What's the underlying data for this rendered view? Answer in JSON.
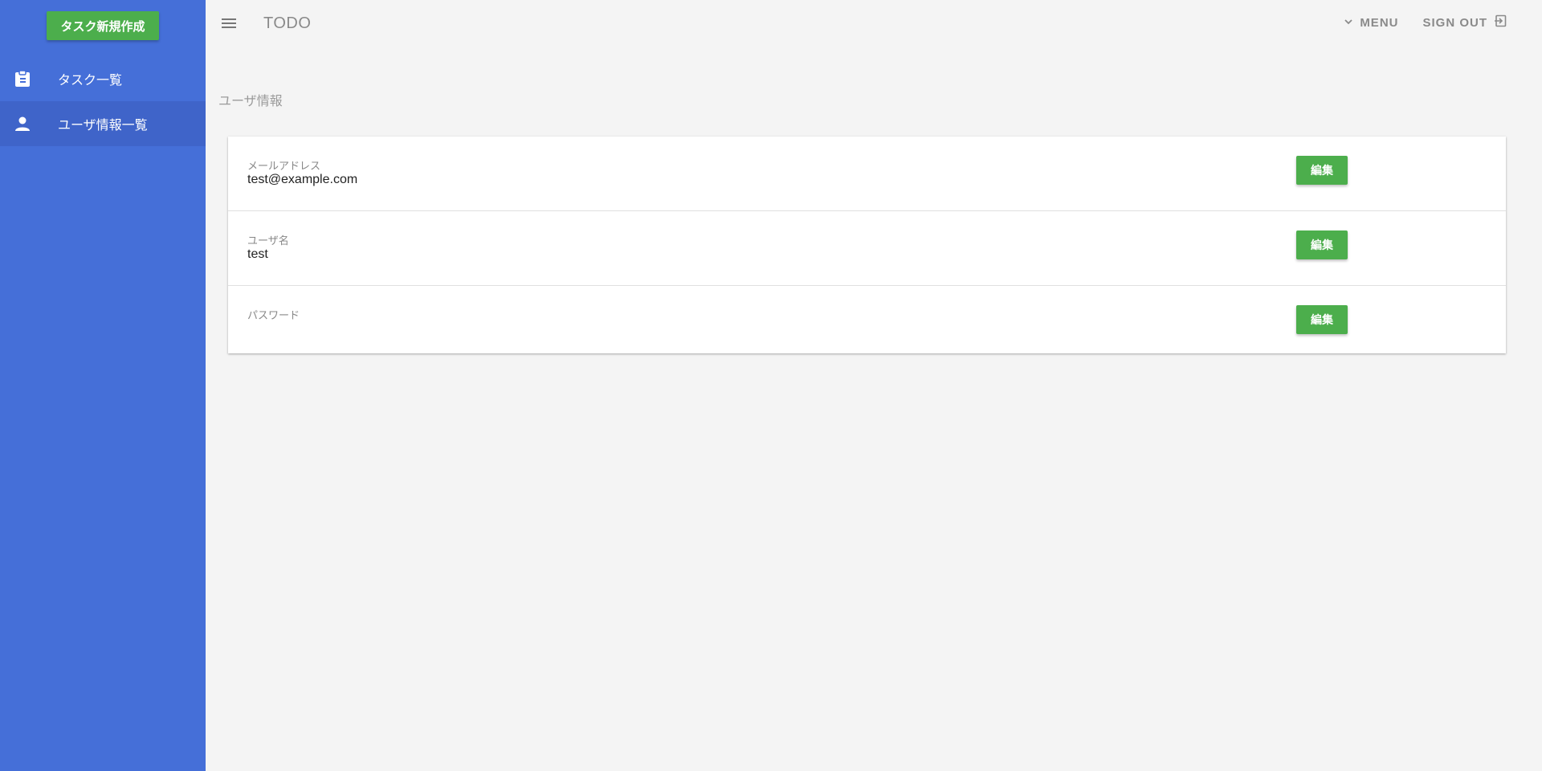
{
  "sidebar": {
    "new_task_label": "タスク新規作成",
    "items": [
      {
        "label": "タスク一覧",
        "icon": "clipboard-icon",
        "active": false
      },
      {
        "label": "ユーザ情報一覧",
        "icon": "person-icon",
        "active": true
      }
    ]
  },
  "topbar": {
    "title": "TODO",
    "menu_label": "MENU",
    "signout_label": "SIGN OUT"
  },
  "page": {
    "heading": "ユーザ情報"
  },
  "user_info": {
    "rows": [
      {
        "label": "メールアドレス",
        "value": "test@example.com",
        "button": "編集"
      },
      {
        "label": "ユーザ名",
        "value": "test",
        "button": "編集"
      },
      {
        "label": "パスワード",
        "value": "",
        "button": "編集"
      }
    ]
  },
  "colors": {
    "sidebar": "#456fd8",
    "sidebar_active": "#3f64c9",
    "accent_green": "#4cae4c",
    "background": "#f4f4f4"
  }
}
